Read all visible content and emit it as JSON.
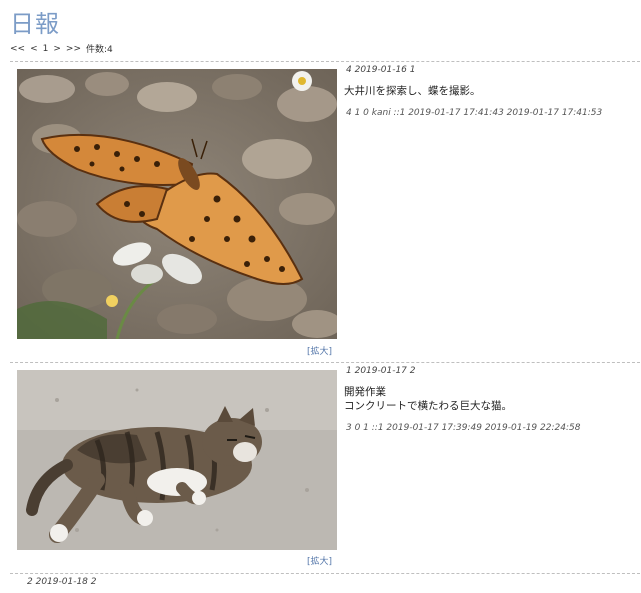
{
  "page": {
    "title": "日報"
  },
  "pager": {
    "first": "<<",
    "prev": "<",
    "page": "1",
    "next": ">",
    "last": ">>",
    "count": "件数:4"
  },
  "entries": [
    {
      "header": "4 2019-01-16 1",
      "lines": [
        "大井川を探索し、蝶を撮影。"
      ],
      "footer": "4 1 0  kani ::1 2019-01-17 17:41:43 2019-01-17 17:41:53",
      "zoom": "[拡大]"
    },
    {
      "header": "1 2019-01-17 2",
      "lines": [
        "開発作業",
        "コンクリートで横たわる巨大な猫。"
      ],
      "footer": "3 0 1   ::1 2019-01-17 17:39:49 2019-01-19 22:24:58",
      "zoom": "[拡大]"
    },
    {
      "header": "2 2019-01-18 2"
    }
  ],
  "colors": {
    "title": "#7c9cc7",
    "link": "#5577aa",
    "divider": "#bfbfbf"
  }
}
